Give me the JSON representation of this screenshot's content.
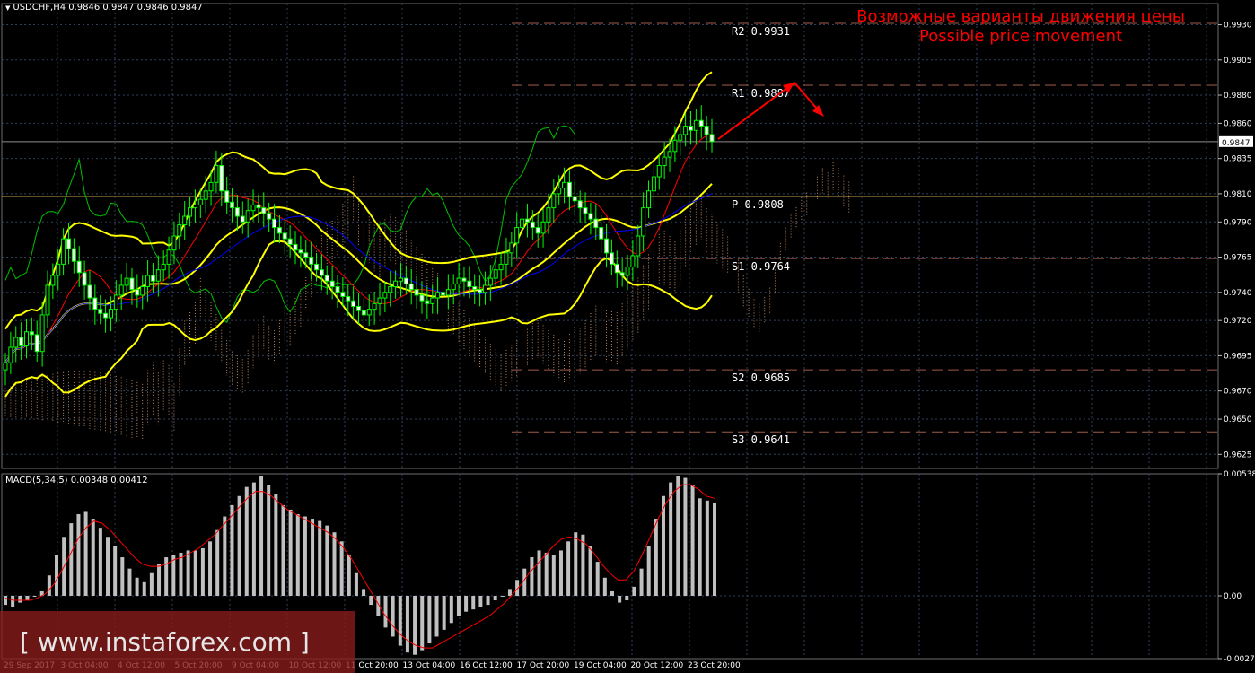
{
  "window": {
    "symbol_line": "USDCHF,H4  0.9846 0.9847 0.9846 0.9847",
    "macd_line": "MACD(5,34,5) 0.00348 0.00412",
    "current_price": "0.9847"
  },
  "annotation": {
    "line_ru": "Возможные варианты движения цены",
    "line_en": "Possible price movement"
  },
  "watermark": "[ www.instaforex.com ]",
  "colors": {
    "background": "#000000",
    "grid": "#30405a",
    "bull_candle": "#ffffff",
    "bear_candle": "#ffffff",
    "bollinger": "#ffff00",
    "tenkan": "#ff0000",
    "kijun": "#0000ff",
    "chikou": "#00c000",
    "cloud": "#e0a070",
    "pivot_dashed": "#a05a4a",
    "pivot_p": "#c8a050",
    "arrow": "#ff0000",
    "macd_hist": "#c0c0c0",
    "macd_signal": "#ff0000",
    "watermark_bg": "#8a1c1c"
  },
  "chart_data": [
    {
      "type": "candlestick",
      "title": "USDCHF,H4",
      "ylim": [
        0.9615,
        0.9945
      ],
      "y_ticks": [
        "0.9930",
        "0.9905",
        "0.9880",
        "0.9860",
        "0.9835",
        "0.9810",
        "0.9790",
        "0.9765",
        "0.9740",
        "0.9720",
        "0.9695",
        "0.9670",
        "0.9650",
        "0.9625"
      ],
      "x_ticks": [
        "29 Sep 2017",
        "3 Oct 04:00",
        "4 Oct 12:00",
        "5 Oct 20:00",
        "9 Oct 04:00",
        "10 Oct 12:00",
        "11 Oct 20:00",
        "13 Oct 04:00",
        "16 Oct 12:00",
        "17 Oct 20:00",
        "19 Oct 04:00",
        "20 Oct 12:00",
        "23 Oct 20:00"
      ],
      "grid": true,
      "close": [
        0.969,
        0.9701,
        0.9708,
        0.9702,
        0.9712,
        0.971,
        0.9698,
        0.9724,
        0.9745,
        0.9752,
        0.976,
        0.9778,
        0.9771,
        0.9762,
        0.9754,
        0.9745,
        0.9736,
        0.9728,
        0.9725,
        0.9722,
        0.9728,
        0.9738,
        0.9745,
        0.975,
        0.9742,
        0.9738,
        0.9744,
        0.9752,
        0.9748,
        0.9756,
        0.976,
        0.977,
        0.978,
        0.9788,
        0.9794,
        0.98,
        0.9802,
        0.9806,
        0.9812,
        0.9818,
        0.983,
        0.9812,
        0.9804,
        0.98,
        0.9794,
        0.979,
        0.9798,
        0.9802,
        0.98,
        0.9796,
        0.9792,
        0.9786,
        0.9782,
        0.9778,
        0.9774,
        0.977,
        0.9768,
        0.9765,
        0.976,
        0.9756,
        0.9752,
        0.9748,
        0.9744,
        0.974,
        0.9737,
        0.9734,
        0.973,
        0.9727,
        0.9724,
        0.9728,
        0.9732,
        0.9736,
        0.974,
        0.9744,
        0.9748,
        0.975,
        0.9746,
        0.9742,
        0.9738,
        0.9734,
        0.9732,
        0.9736,
        0.974,
        0.9738,
        0.9742,
        0.9746,
        0.975,
        0.9748,
        0.9744,
        0.9742,
        0.974,
        0.9745,
        0.975,
        0.9756,
        0.976,
        0.9768,
        0.9775,
        0.9786,
        0.9792,
        0.979,
        0.9786,
        0.9782,
        0.979,
        0.98,
        0.981,
        0.9814,
        0.9818,
        0.9808,
        0.9805,
        0.98,
        0.9796,
        0.9792,
        0.9786,
        0.9778,
        0.9768,
        0.976,
        0.9754,
        0.9752,
        0.9758,
        0.9766,
        0.978,
        0.98,
        0.9812,
        0.9822,
        0.983,
        0.9836,
        0.984,
        0.9848,
        0.9852,
        0.9858,
        0.9855,
        0.9862,
        0.9858,
        0.9852,
        0.9847
      ],
      "pivot_levels": [
        {
          "label": "R2",
          "value": "0.9931"
        },
        {
          "label": "R1",
          "value": "0.9887"
        },
        {
          "label": "P",
          "value": "0.9808"
        },
        {
          "label": "S1",
          "value": "0.9764"
        },
        {
          "label": "S2",
          "value": "0.9685"
        },
        {
          "label": "S3",
          "value": "0.9641"
        }
      ],
      "pivot_values": [
        0.9931,
        0.9887,
        0.9808,
        0.9764,
        0.9685,
        0.9641
      ],
      "indicators": [
        "Bollinger Bands",
        "Ichimoku"
      ]
    },
    {
      "type": "bar",
      "title": "MACD(5,34,5)",
      "ylim": [
        -0.00277,
        0.00538
      ],
      "y_ticks": [
        "0.00538",
        "0.00",
        "-0.00277"
      ],
      "values_note": "histogram and signal line",
      "hist": [
        -0.0004,
        -0.0005,
        -0.0003,
        -0.0002,
        0.0,
        0.0002,
        0.0009,
        0.0018,
        0.0026,
        0.0032,
        0.0036,
        0.0037,
        0.0034,
        0.003,
        0.0026,
        0.0022,
        0.0017,
        0.0012,
        0.0008,
        0.0006,
        0.001,
        0.0014,
        0.0017,
        0.0018,
        0.0019,
        0.002,
        0.002,
        0.0021,
        0.0024,
        0.0029,
        0.0035,
        0.004,
        0.0044,
        0.0048,
        0.005,
        0.0053,
        0.0049,
        0.0045,
        0.004,
        0.0038,
        0.0036,
        0.0035,
        0.0034,
        0.0033,
        0.0031,
        0.0028,
        0.0024,
        0.0018,
        0.001,
        0.0003,
        -0.0004,
        -0.0009,
        -0.0014,
        -0.0018,
        -0.0022,
        -0.0025,
        -0.0026,
        -0.0024,
        -0.0021,
        -0.0018,
        -0.0015,
        -0.0012,
        -0.0009,
        -0.0007,
        -0.0006,
        -0.0005,
        -0.0004,
        -0.0002,
        0.0,
        0.0003,
        0.0007,
        0.0012,
        0.0017,
        0.002,
        0.0019,
        0.0018,
        0.002,
        0.0024,
        0.0028,
        0.0027,
        0.0022,
        0.0015,
        0.0008,
        0.0002,
        -0.0003,
        -0.0002,
        0.0004,
        0.0012,
        0.0022,
        0.0034,
        0.0044,
        0.005,
        0.0053,
        0.0052,
        0.0049,
        0.0043,
        0.0042,
        0.0041
      ],
      "signal": [
        -0.0001,
        -0.0002,
        -0.0002,
        -0.0002,
        -0.0001,
        0.0001,
        0.0005,
        0.0011,
        0.0018,
        0.0025,
        0.003,
        0.0033,
        0.0032,
        0.0029,
        0.0025,
        0.0021,
        0.0017,
        0.0014,
        0.0013,
        0.0013,
        0.0014,
        0.0016,
        0.0017,
        0.0019,
        0.0021,
        0.0024,
        0.0027,
        0.0031,
        0.0035,
        0.0039,
        0.0043,
        0.0046,
        0.0046,
        0.0044,
        0.0041,
        0.0038,
        0.0036,
        0.0034,
        0.0032,
        0.003,
        0.0028,
        0.0025,
        0.0021,
        0.0016,
        0.001,
        0.0004,
        -0.0002,
        -0.0008,
        -0.0013,
        -0.0017,
        -0.002,
        -0.0022,
        -0.0023,
        -0.0023,
        -0.0021,
        -0.0019,
        -0.0017,
        -0.0015,
        -0.0013,
        -0.0011,
        -0.0009,
        -0.0006,
        -0.0003,
        0.0001,
        0.0005,
        0.001,
        0.0014,
        0.0018,
        0.0022,
        0.0025,
        0.0026,
        0.0025,
        0.0023,
        0.0019,
        0.0014,
        0.001,
        0.0007,
        0.0007,
        0.0011,
        0.0018,
        0.0026,
        0.0034,
        0.0041,
        0.0046,
        0.0049,
        0.0049,
        0.0047,
        0.0044,
        0.0043
      ]
    }
  ]
}
